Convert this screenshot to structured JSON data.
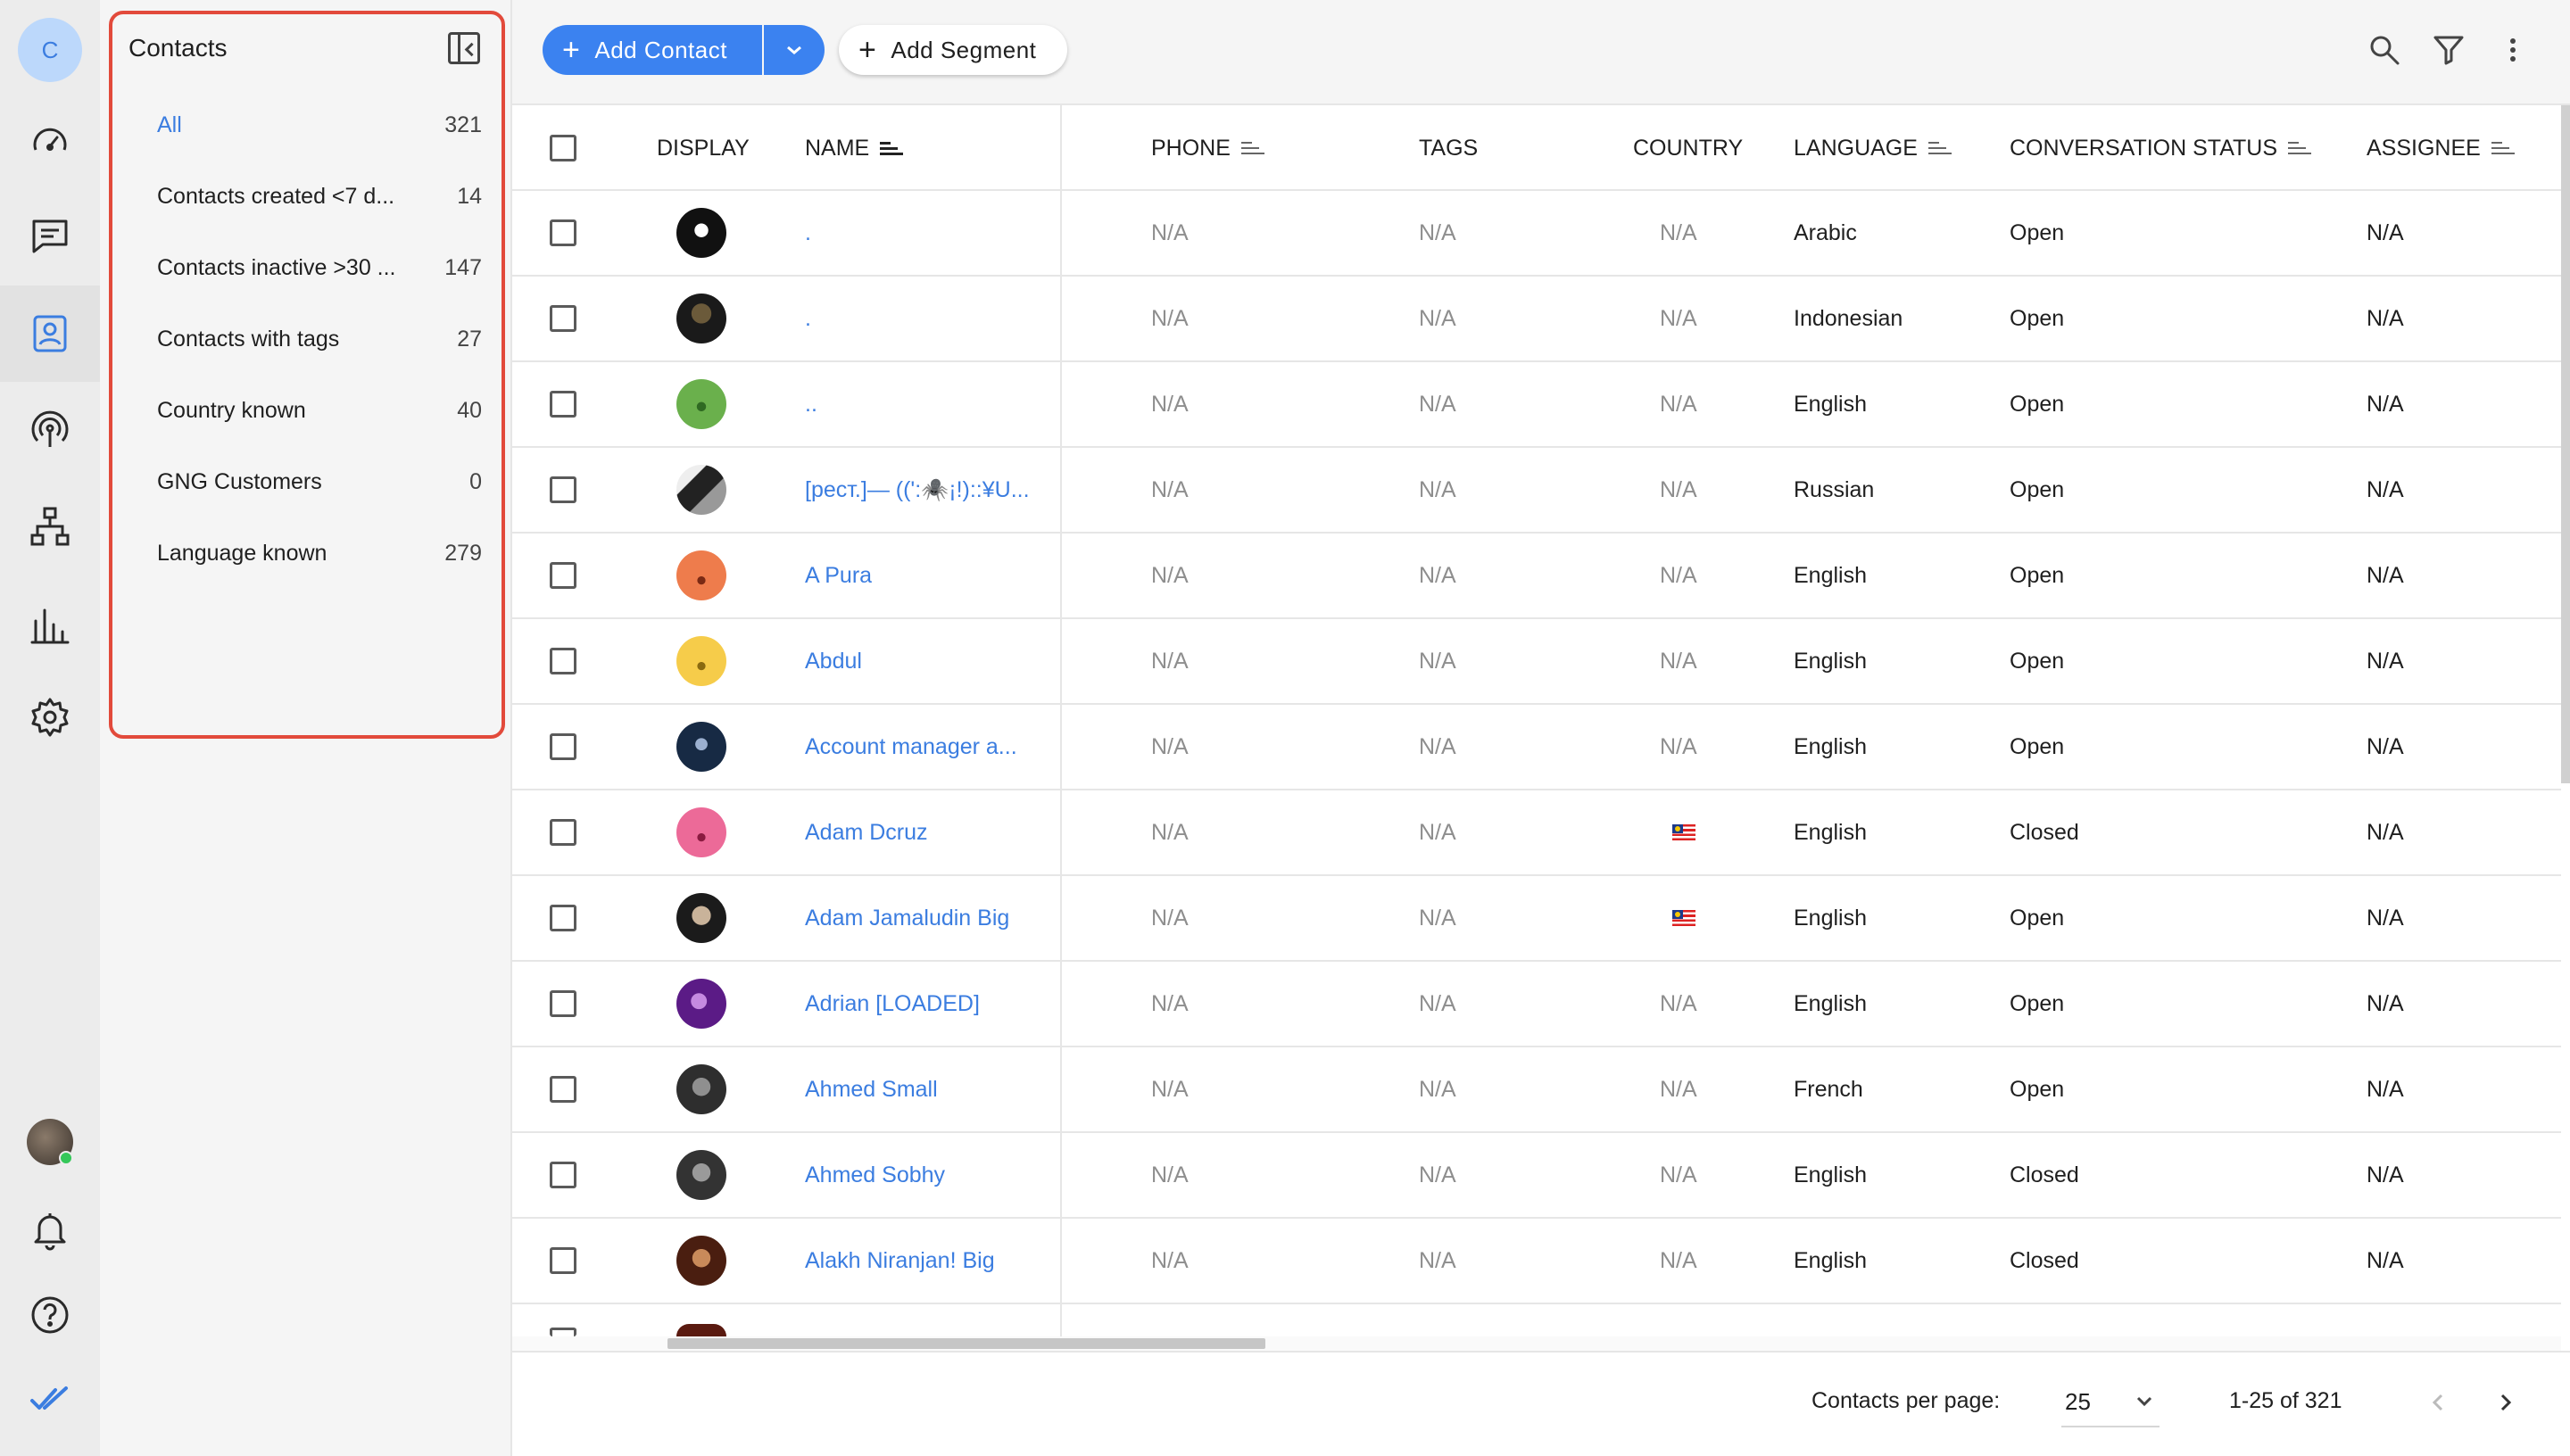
{
  "workspace": {
    "initial": "C"
  },
  "nav": {
    "items": [
      {
        "icon": "dashboard-gauge-icon"
      },
      {
        "icon": "conversations-icon"
      },
      {
        "icon": "contacts-icon",
        "active": true
      },
      {
        "icon": "broadcast-icon"
      },
      {
        "icon": "workflows-icon"
      },
      {
        "icon": "reports-icon"
      },
      {
        "icon": "settings-icon"
      }
    ],
    "bottom": [
      {
        "icon": "user-avatar"
      },
      {
        "icon": "notifications-bell-icon"
      },
      {
        "icon": "help-icon"
      },
      {
        "icon": "brand-checkmark-icon"
      }
    ]
  },
  "segments": {
    "title": "Contacts",
    "items": [
      {
        "label": "All",
        "count": "321",
        "active": true
      },
      {
        "label": "Contacts created <7 d...",
        "count": "14"
      },
      {
        "label": "Contacts inactive >30 ...",
        "count": "147"
      },
      {
        "label": "Contacts with tags",
        "count": "27"
      },
      {
        "label": "Country known",
        "count": "40"
      },
      {
        "label": "GNG Customers",
        "count": "0"
      },
      {
        "label": "Language known",
        "count": "279"
      }
    ]
  },
  "toolbar": {
    "add_contact_label": "Add Contact",
    "add_segment_label": "Add Segment",
    "accent": "#3b82f0"
  },
  "table": {
    "columns": {
      "display": "DISPLAY",
      "name": "NAME",
      "phone": "PHONE",
      "tags": "TAGS",
      "country": "COUNTRY",
      "language": "LANGUAGE",
      "status": "CONVERSATION STATUS",
      "assignee": "ASSIGNEE"
    },
    "rows": [
      {
        "name": ".",
        "phone": "N/A",
        "tags": "N/A",
        "country": "N/A",
        "language": "Arabic",
        "status": "Open",
        "assignee": "N/A"
      },
      {
        "name": ".",
        "phone": "N/A",
        "tags": "N/A",
        "country": "N/A",
        "language": "Indonesian",
        "status": "Open",
        "assignee": "N/A"
      },
      {
        "name": "..",
        "phone": "N/A",
        "tags": "N/A",
        "country": "N/A",
        "language": "English",
        "status": "Open",
        "assignee": "N/A"
      },
      {
        "name": "[рест.]— ((':🕷️¡!)::¥U...",
        "phone": "N/A",
        "tags": "N/A",
        "country": "N/A",
        "language": "Russian",
        "status": "Open",
        "assignee": "N/A"
      },
      {
        "name": "A Pura",
        "phone": "N/A",
        "tags": "N/A",
        "country": "N/A",
        "language": "English",
        "status": "Open",
        "assignee": "N/A"
      },
      {
        "name": "Abdul",
        "phone": "N/A",
        "tags": "N/A",
        "country": "N/A",
        "language": "English",
        "status": "Open",
        "assignee": "N/A"
      },
      {
        "name": "Account manager a...",
        "phone": "N/A",
        "tags": "N/A",
        "country": "N/A",
        "language": "English",
        "status": "Open",
        "assignee": "N/A"
      },
      {
        "name": "Adam Dcruz",
        "phone": "N/A",
        "tags": "N/A",
        "country": "",
        "language": "English",
        "status": "Closed",
        "assignee": "N/A"
      },
      {
        "name": "Adam Jamaludin Big",
        "phone": "N/A",
        "tags": "N/A",
        "country": "",
        "language": "English",
        "status": "Open",
        "assignee": "N/A"
      },
      {
        "name": "Adrian [LOADED]",
        "phone": "N/A",
        "tags": "N/A",
        "country": "N/A",
        "language": "English",
        "status": "Open",
        "assignee": "N/A"
      },
      {
        "name": "Ahmed Small",
        "phone": "N/A",
        "tags": "N/A",
        "country": "N/A",
        "language": "French",
        "status": "Open",
        "assignee": "N/A"
      },
      {
        "name": "Ahmed Sobhy",
        "phone": "N/A",
        "tags": "N/A",
        "country": "N/A",
        "language": "English",
        "status": "Closed",
        "assignee": "N/A"
      },
      {
        "name": "Alakh Niranjan! Big",
        "phone": "N/A",
        "tags": "N/A",
        "country": "N/A",
        "language": "English",
        "status": "Closed",
        "assignee": "N/A"
      }
    ]
  },
  "footer": {
    "per_page_label": "Contacts per page:",
    "per_page_value": "25",
    "range": "1-25 of 321"
  }
}
